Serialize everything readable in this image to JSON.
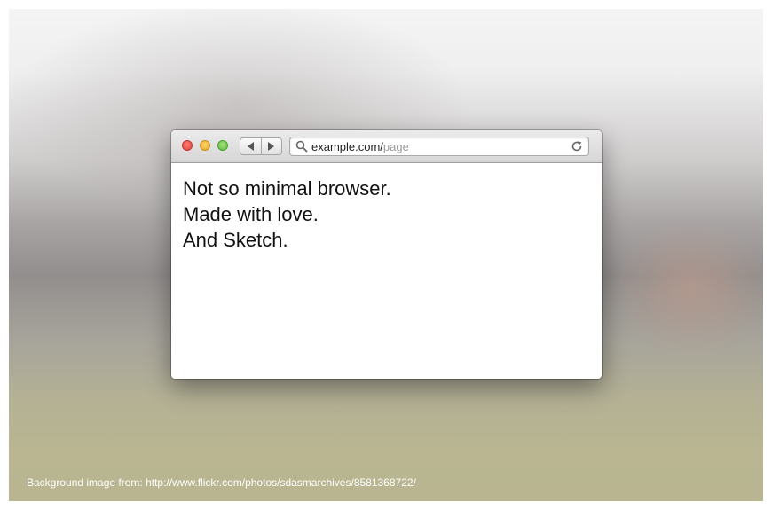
{
  "browser": {
    "window_controls": [
      "close",
      "minimize",
      "maximize"
    ],
    "nav": {
      "back_icon": "back-arrow-icon",
      "forward_icon": "forward-arrow-icon"
    },
    "address_bar": {
      "domain": "example.com/",
      "path": "page",
      "leading_icon": "search-icon",
      "trailing_icon": "reload-icon"
    },
    "content": {
      "lines": [
        "Not so minimal browser.",
        "Made with love.",
        "And Sketch."
      ]
    }
  },
  "footer": {
    "credit": "Background image from: http://www.flickr.com/photos/sdasmarchives/8581368722/"
  },
  "colors": {
    "close": "#e0443e",
    "minimize": "#e2a82a",
    "maximize": "#5cbd3d",
    "url_path": "#9b9b9b"
  }
}
